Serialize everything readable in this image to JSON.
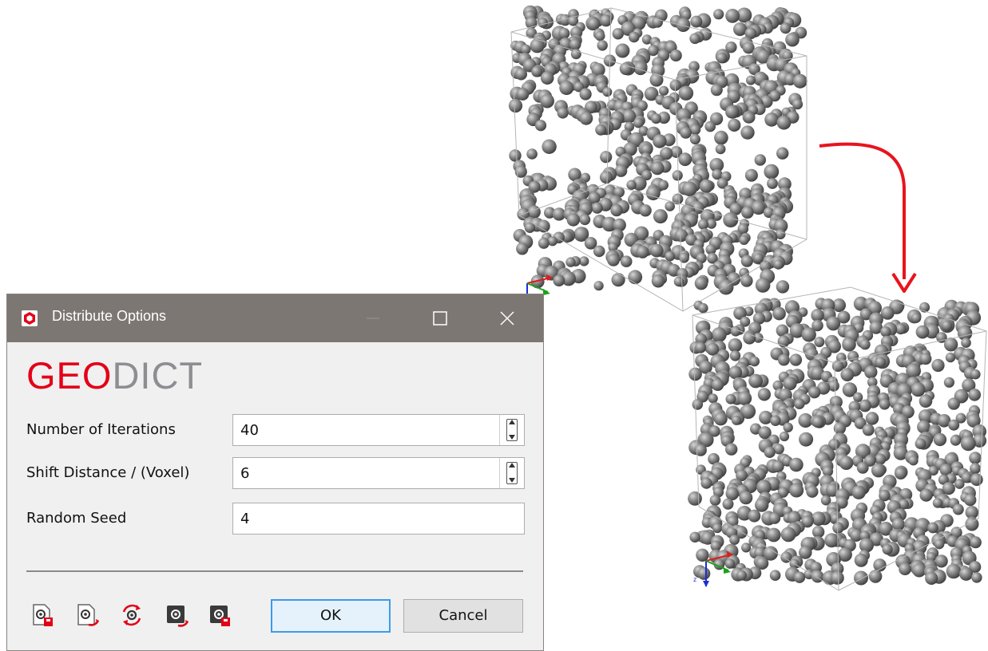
{
  "dialog": {
    "title": "Distribute Options",
    "app_icon": "geodict-cube-icon",
    "logo": {
      "part1": "GEO",
      "part2": "DICT"
    },
    "fields": [
      {
        "label": "Number of Iterations",
        "value": "40",
        "spinner": true
      },
      {
        "label": "Shift Distance / (Voxel)",
        "value": "6",
        "spinner": true
      },
      {
        "label": "Random Seed",
        "value": "4",
        "spinner": false
      }
    ],
    "toolbar_icons": [
      "load-settings-icon",
      "save-settings-icon",
      "reset-settings-icon",
      "load-macro-icon",
      "save-macro-icon"
    ],
    "ok_label": "OK",
    "cancel_label": "Cancel"
  },
  "views": [
    {
      "name": "before-distribution",
      "particles": "spheres-clustered-top-bottom",
      "axes": [
        "x",
        "y",
        "z"
      ]
    },
    {
      "name": "after-distribution",
      "particles": "spheres-uniform",
      "axes": [
        "x",
        "y",
        "z"
      ]
    }
  ],
  "colors": {
    "accent": "#e30018",
    "arrow": "#e8141e",
    "titlebar": "#7d7773",
    "particle": "#8c8c8c"
  }
}
